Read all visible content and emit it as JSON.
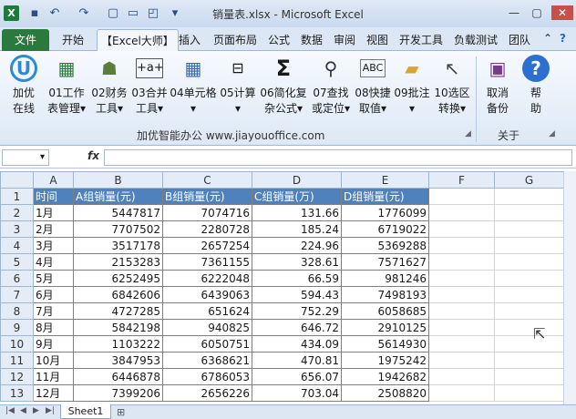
{
  "window": {
    "title": "销量表.xlsx  -  Microsoft Excel",
    "logo": "X"
  },
  "tabs": [
    "文件",
    "开始",
    "【Excel大师】",
    "插入",
    "页面布局",
    "公式",
    "数据",
    "审阅",
    "视图",
    "开发工具",
    "负载测试",
    "团队"
  ],
  "ribbon": {
    "buttons": [
      {
        "id": "jiayou",
        "line1": "加优",
        "line2": "在线",
        "icon": "jiayou-logo-icon"
      },
      {
        "id": "worksheet",
        "line1": "01工作",
        "line2": "表管理▾",
        "icon": "worksheet-icon"
      },
      {
        "id": "finance",
        "line1": "02财务",
        "line2": "工具▾",
        "icon": "finance-icon"
      },
      {
        "id": "merge",
        "line1": "03合并",
        "line2": "工具▾",
        "icon": "merge-icon"
      },
      {
        "id": "cell",
        "line1": "04单元格",
        "line2": "▾",
        "icon": "cell-grid-icon"
      },
      {
        "id": "calc",
        "line1": "05计算",
        "line2": "▾",
        "icon": "calc-icon"
      },
      {
        "id": "formula",
        "line1": "06简化复",
        "line2": "杂公式▾",
        "icon": "sigma-icon"
      },
      {
        "id": "find",
        "line1": "07查找",
        "line2": "或定位▾",
        "icon": "binoculars-icon"
      },
      {
        "id": "quick",
        "line1": "08快捷",
        "line2": "取值▾",
        "icon": "abc-icon"
      },
      {
        "id": "annot",
        "line1": "09批注",
        "line2": "▾",
        "icon": "comment-icon"
      },
      {
        "id": "select",
        "line1": "10选区",
        "line2": "转换▾",
        "icon": "cursor-icon"
      },
      {
        "id": "cancel",
        "line1": "取消",
        "line2": "备份",
        "icon": "cancel-backup-icon"
      },
      {
        "id": "help",
        "line1": "帮",
        "line2": "助",
        "icon": "help-icon"
      }
    ],
    "group1_label": "加优智能办公  www.jiayouoffice.com",
    "group2_label": "关于"
  },
  "formula_bar": {
    "name_box": "▾",
    "fx": "fx",
    "value": ""
  },
  "columns": [
    "A",
    "B",
    "C",
    "D",
    "E",
    "F",
    "G"
  ],
  "header_row": [
    "时间",
    "A组销量(元)",
    "B组销量(元)",
    "C组销量(万)",
    "D组销量(元)"
  ],
  "rows": [
    [
      "1月",
      "5447817",
      "7074716",
      "131.66",
      "1776099"
    ],
    [
      "2月",
      "7707502",
      "2280728",
      "185.24",
      "6719022"
    ],
    [
      "3月",
      "3517178",
      "2657254",
      "224.96",
      "5369288"
    ],
    [
      "4月",
      "2153283",
      "7361155",
      "328.61",
      "7571627"
    ],
    [
      "5月",
      "6252495",
      "6222048",
      "66.59",
      "981246"
    ],
    [
      "6月",
      "6842606",
      "6439063",
      "594.43",
      "7498193"
    ],
    [
      "7月",
      "4727285",
      "651624",
      "752.29",
      "6058685"
    ],
    [
      "8月",
      "5842198",
      "940825",
      "646.72",
      "2910125"
    ],
    [
      "9月",
      "1103222",
      "6050751",
      "434.09",
      "5614930"
    ],
    [
      "10月",
      "3847953",
      "6368621",
      "470.81",
      "1975242"
    ],
    [
      "11月",
      "6446878",
      "6786053",
      "656.07",
      "1942682"
    ],
    [
      "12月",
      "7399206",
      "2656226",
      "703.04",
      "2508820"
    ]
  ],
  "sheets": [
    "Sheet1"
  ]
}
